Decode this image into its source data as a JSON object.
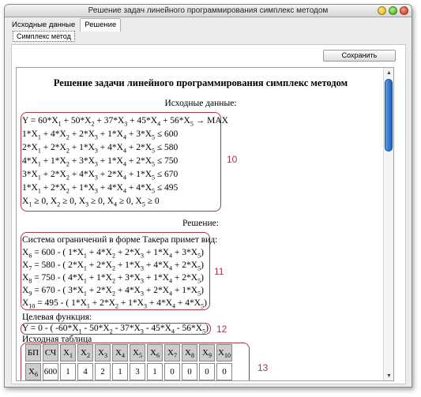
{
  "window": {
    "title": "Решение задач линейного программирования симплекс методом"
  },
  "tabs": [
    {
      "label": "Исходные данные"
    },
    {
      "label": "Решение"
    }
  ],
  "subtab": {
    "label": "Симплекс метод"
  },
  "toolbar": {
    "save_label": "Сохранить"
  },
  "doc": {
    "title": "Решение задачи линейного программирования симплекс методом",
    "input_heading": "Исходные данные:",
    "solution_heading": "Решение:",
    "objective_heading": "Целевая функция:",
    "table_heading": "Исходная таблица",
    "tucker_intro": "Система ограничений в форме Такера примет вид:"
  },
  "annotations": [
    "10",
    "11",
    "12",
    "13"
  ],
  "simplex_table": {
    "headers": [
      "БП",
      "СЧ",
      "X1",
      "X2",
      "X3",
      "X4",
      "X5",
      "X6",
      "X7",
      "X8",
      "X9",
      "X10"
    ],
    "rows": [
      {
        "basis": "X6",
        "values": [
          "600",
          "1",
          "4",
          "2",
          "1",
          "3",
          "1",
          "0",
          "0",
          "0",
          "0"
        ]
      }
    ]
  }
}
